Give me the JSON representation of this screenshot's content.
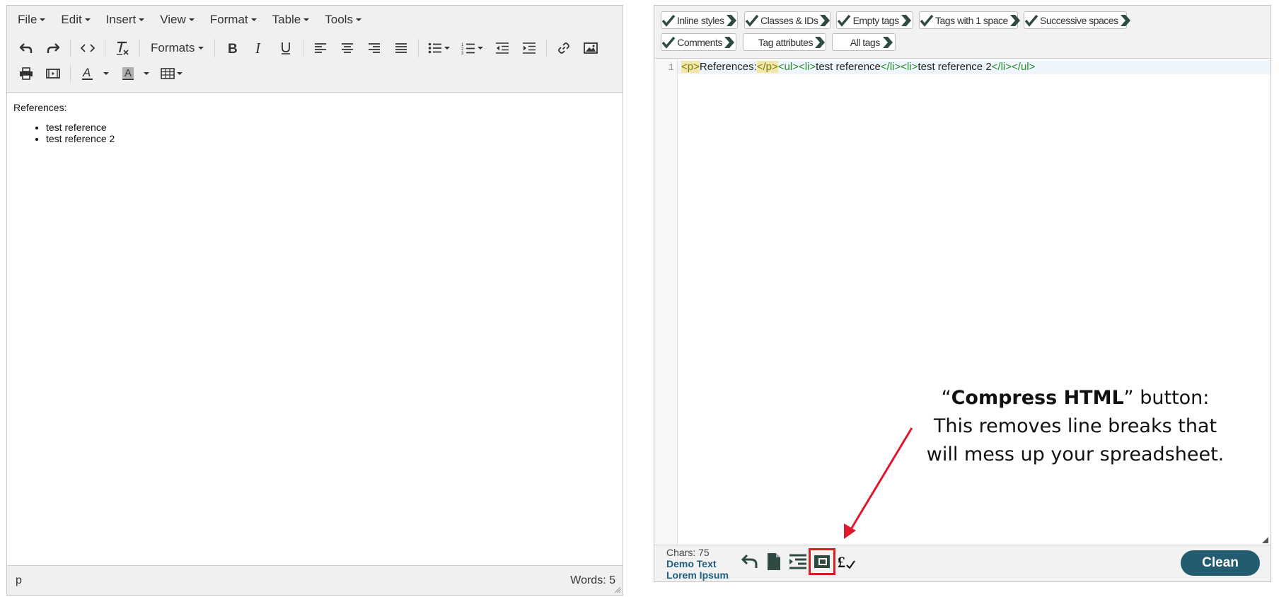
{
  "left_editor": {
    "menu": [
      "File",
      "Edit",
      "Insert",
      "View",
      "Format",
      "Table",
      "Tools"
    ],
    "formats_label": "Formats",
    "content": {
      "paragraph": "References:",
      "list_items": [
        "test reference",
        "test reference 2"
      ]
    },
    "status": {
      "path": "p",
      "words": "Words: 5"
    }
  },
  "right_panel": {
    "options": [
      {
        "label": "Inline styles",
        "checked": true
      },
      {
        "label": "Classes & IDs",
        "checked": true
      },
      {
        "label": "Empty tags",
        "checked": true
      },
      {
        "label": "Tags with 1 space",
        "checked": true
      },
      {
        "label": "Successive spaces",
        "checked": true
      },
      {
        "label": "Comments",
        "checked": true
      },
      {
        "label": "Tag attributes",
        "checked": false
      },
      {
        "label": "All tags",
        "checked": false
      }
    ],
    "code": {
      "line_number": "1",
      "tokens": [
        "<p>",
        "References:",
        "</p>",
        "<ul>",
        "<li>",
        "test reference",
        "</li>",
        "<li>",
        "test reference 2",
        "</li>",
        "</ul>"
      ]
    },
    "chars": "Chars: 75",
    "demo_text_line1": "Demo Text",
    "demo_text_line2": "Lorem Ipsum",
    "clean_label": "Clean"
  },
  "annotation": {
    "open_quote": "“",
    "bold": "Compress HTML",
    "rest_line1": "” button:",
    "line2": "This removes line breaks that",
    "line3": "will mess up your spreadsheet."
  },
  "colors": {
    "accent": "#235c6e",
    "check_green": "#2f4a42",
    "highlight_red": "#d42020",
    "tag_green": "#2a8a2a"
  }
}
